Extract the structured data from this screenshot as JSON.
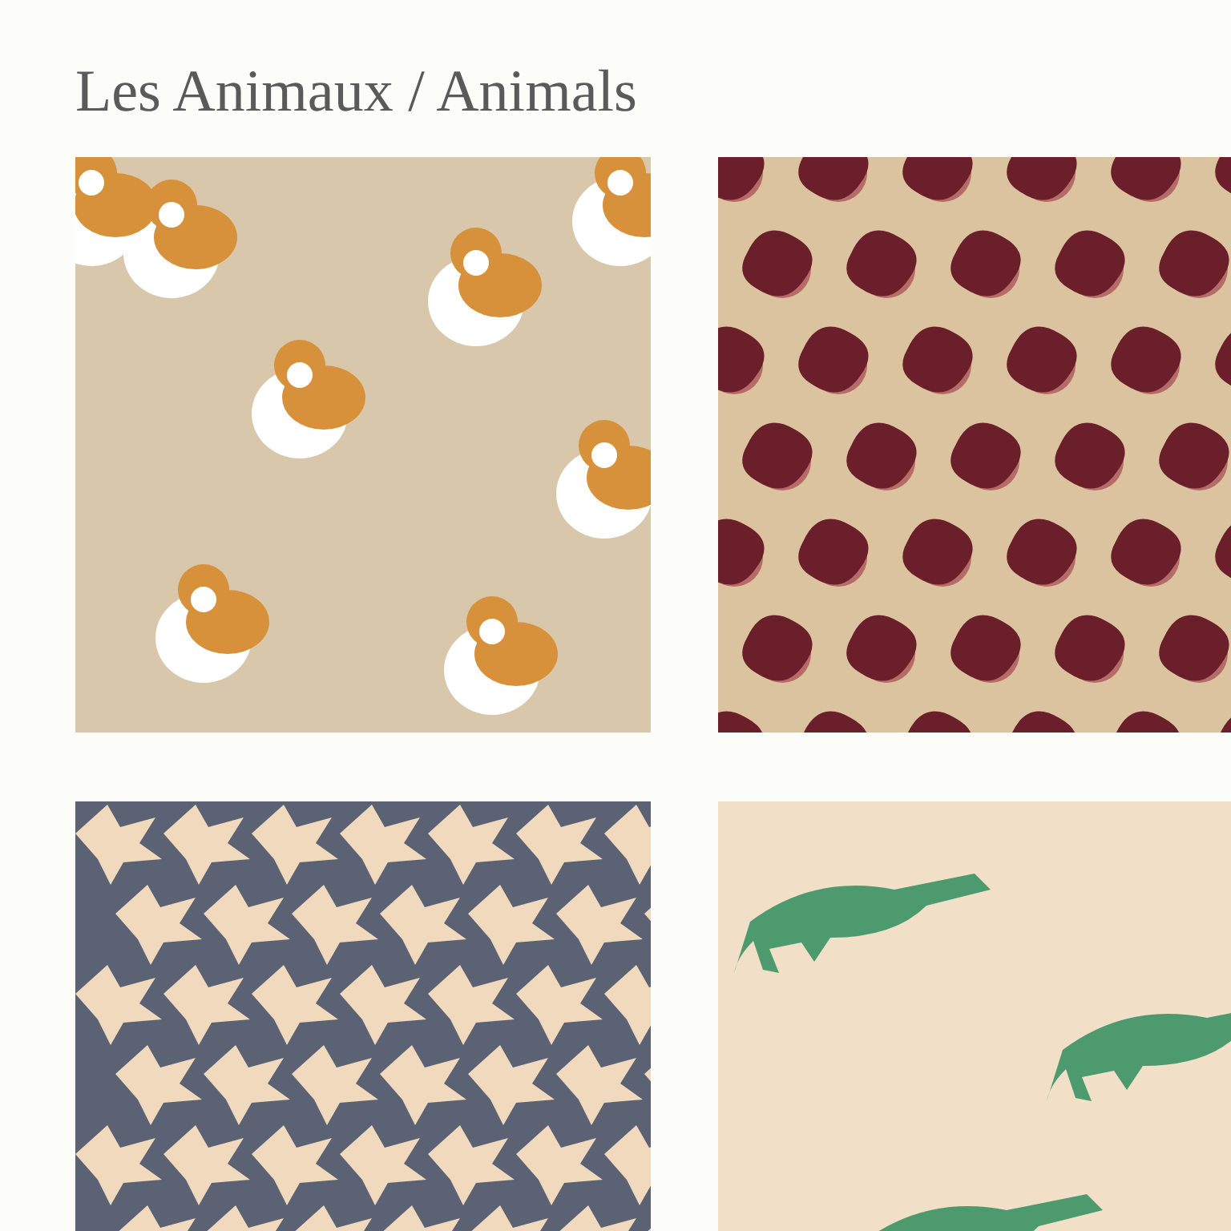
{
  "title": "Les Animaux / Animals",
  "gallery": [
    {
      "kind": "corgi"
    },
    {
      "kind": "leopard"
    },
    {
      "kind": "bird"
    },
    {
      "kind": "crocodile"
    }
  ]
}
